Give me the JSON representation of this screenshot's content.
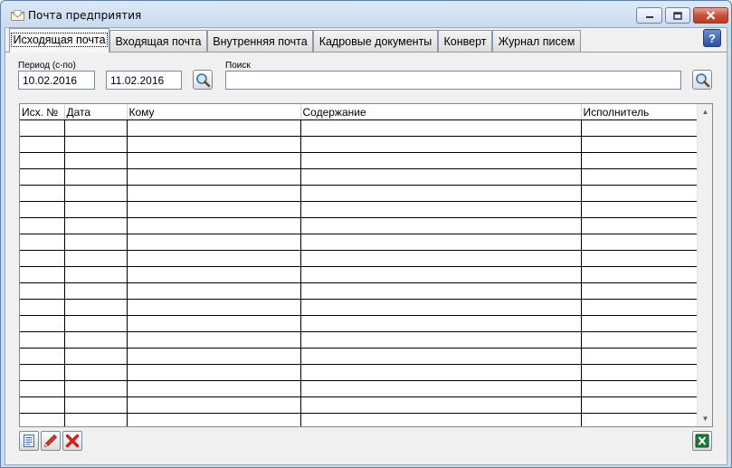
{
  "window": {
    "title": "Почта предприятия",
    "icons": {
      "app": "envelope-icon",
      "minimize": "minimize-icon",
      "maximize": "maximize-icon",
      "close": "close-icon"
    }
  },
  "tabs": [
    {
      "label": "Исходящая почта",
      "active": true
    },
    {
      "label": "Входящая почта",
      "active": false
    },
    {
      "label": "Внутренняя почта",
      "active": false
    },
    {
      "label": "Кадровые документы",
      "active": false
    },
    {
      "label": "Конверт",
      "active": false
    },
    {
      "label": "Журнал писем",
      "active": false
    }
  ],
  "help": {
    "label": "?",
    "icon": "help-icon"
  },
  "filter": {
    "period_label": "Период (с-по)",
    "date_from": "10.02.2016",
    "date_to": "11.02.2016",
    "search_label": "Поиск",
    "search_value": "",
    "search_icon": "magnifier-icon"
  },
  "table": {
    "columns": [
      "Исх. №",
      "Дата",
      "Кому",
      "Содержание",
      "Исполнитель"
    ],
    "rows": []
  },
  "toolbar": {
    "new_icon": "new-document-icon",
    "edit_icon": "pencil-icon",
    "delete_icon": "delete-x-icon",
    "export_icon": "excel-export-icon"
  },
  "colors": {
    "title_bar": "#c9dbf0",
    "close_button": "#c8513c",
    "help_button": "#2d4f9c",
    "excel_green": "#1e7a34",
    "delete_red": "#d42020"
  }
}
